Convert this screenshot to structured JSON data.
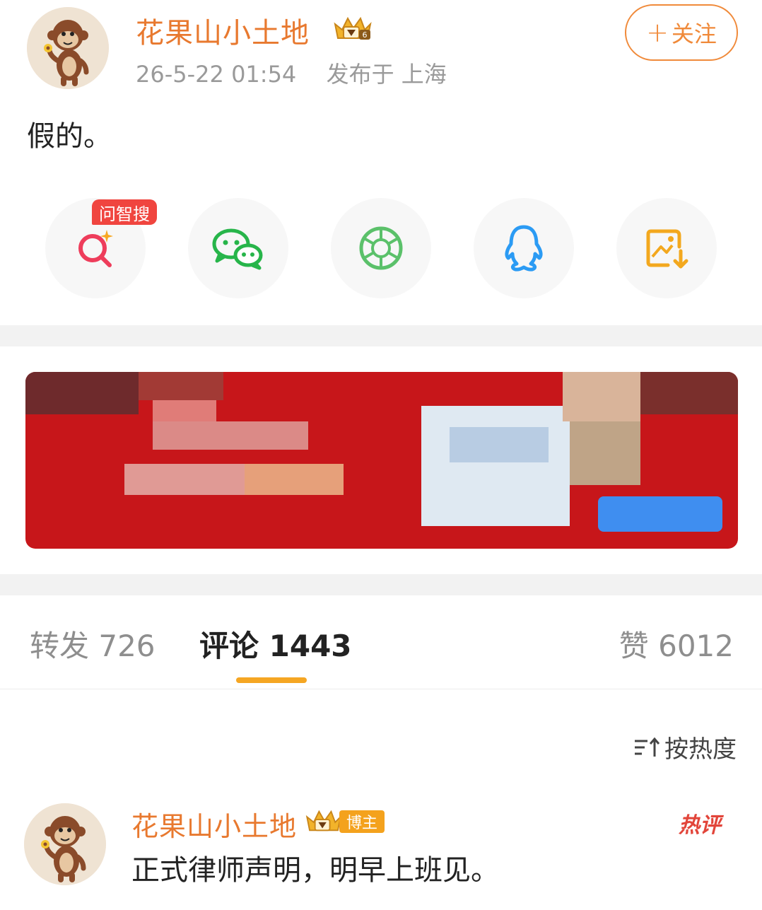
{
  "post": {
    "author_name": "花果山小土地",
    "timestamp": "26-5-22 01:54",
    "location": "发布于 上海",
    "follow_plus": "+",
    "follow_label": "关注",
    "text": "假的。"
  },
  "share": {
    "ai_tag": "问智搜",
    "items": [
      {
        "name": "ai-search",
        "icon": "sparkle-search-icon"
      },
      {
        "name": "wechat",
        "icon": "wechat-icon"
      },
      {
        "name": "moments",
        "icon": "wechat-moments-icon"
      },
      {
        "name": "qq",
        "icon": "qq-penguin-icon"
      },
      {
        "name": "save-image",
        "icon": "image-download-icon"
      }
    ]
  },
  "stats": {
    "repost_label": "转发 726",
    "comment_label": "评论 1443",
    "like_label": "赞 6012"
  },
  "sort": {
    "label": "按热度"
  },
  "comment": {
    "author_name": "花果山小土地",
    "author_tag": "博主",
    "hot_label": "热评",
    "text": "正式律师声明，明早上班见。"
  },
  "colors": {
    "accent_orange": "#e8792f",
    "tab_indicator": "#f5a623",
    "hot_red": "#e2453a",
    "ad_red": "#c7161a"
  }
}
